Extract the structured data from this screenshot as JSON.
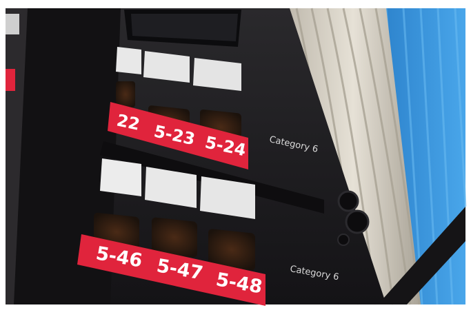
{
  "scene": {
    "subject": "patch-panel-photo"
  },
  "patch_panel": {
    "upper_row": {
      "ports": [
        {
          "label": "22"
        },
        {
          "label": "5-23"
        },
        {
          "label": "5-24"
        }
      ],
      "brand": "Category 6"
    },
    "lower_row": {
      "ports": [
        {
          "label": "5-46"
        },
        {
          "label": "5-47"
        },
        {
          "label": "5-48"
        }
      ],
      "brand": "Category 6"
    }
  },
  "colors": {
    "label_strip": "#e0243c",
    "panel": "#1c1b1d",
    "jack": "#2a1a12",
    "cables": "#d8d2c6",
    "background_blue": "#2f8fd8"
  }
}
